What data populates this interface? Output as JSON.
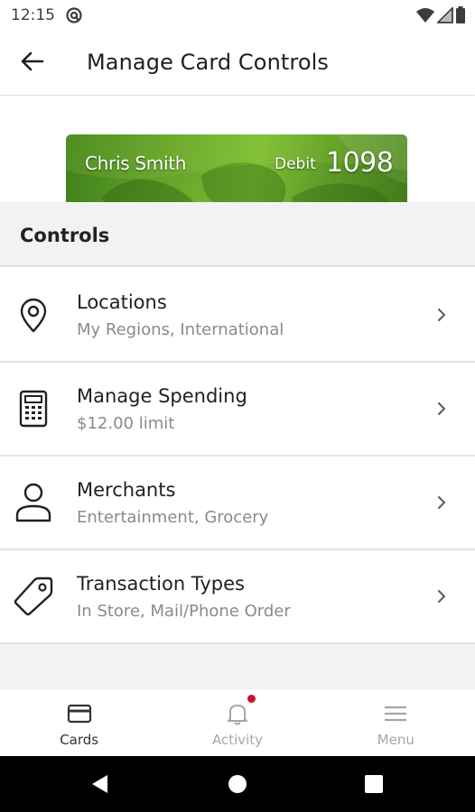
{
  "status_bar": {
    "time": "12:15",
    "left_icon": "at-sign-icon",
    "right_icons": [
      "wifi-icon",
      "signal-icon",
      "battery-icon"
    ]
  },
  "app_bar": {
    "back_icon": "arrow-left-icon",
    "title": "Manage Card Controls"
  },
  "card": {
    "holder_name": "Chris Smith",
    "type": "Debit",
    "last4": "1098",
    "color": "#6aa82c"
  },
  "section": {
    "title": "Controls"
  },
  "controls": [
    {
      "icon": "location-pin-icon",
      "title": "Locations",
      "subtitle": "My Regions, International"
    },
    {
      "icon": "calculator-icon",
      "title": "Manage Spending",
      "subtitle": "$12.00 limit"
    },
    {
      "icon": "person-icon",
      "title": "Merchants",
      "subtitle": "Entertainment, Grocery"
    },
    {
      "icon": "tag-icon",
      "title": "Transaction Types",
      "subtitle": "In Store, Mail/Phone Order"
    }
  ],
  "bottom_nav": {
    "items": [
      {
        "label": "Cards",
        "icon": "card-icon",
        "active": true
      },
      {
        "label": "Activity",
        "icon": "bell-icon",
        "active": false
      },
      {
        "label": "Menu",
        "icon": "hamburger-icon",
        "active": false
      }
    ],
    "notification_color": "#c8102e"
  },
  "system_nav": {
    "buttons": [
      "back-triangle-icon",
      "home-circle-icon",
      "recents-square-icon"
    ]
  }
}
